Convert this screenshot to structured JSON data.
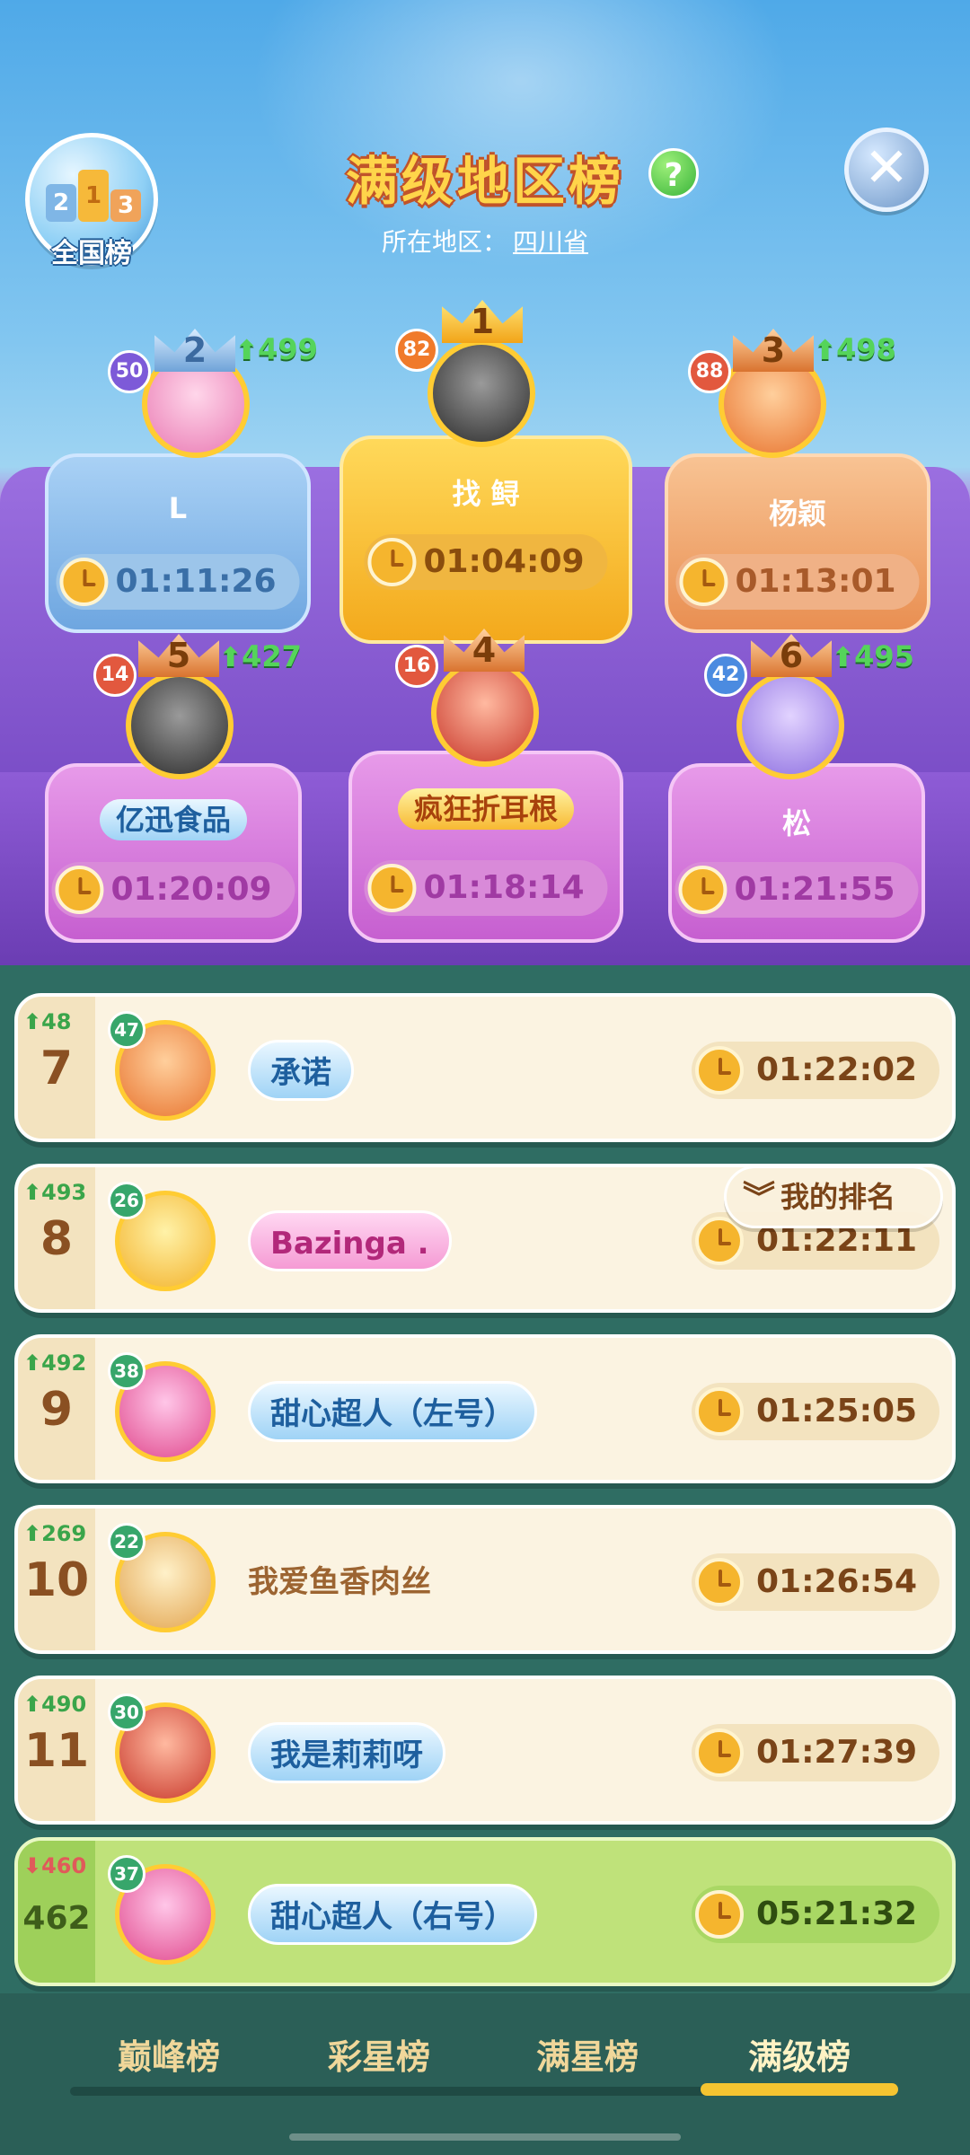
{
  "header": {
    "title": "满级地区榜",
    "region_label": "所在地区：",
    "region_value": "四川省",
    "national_button_label": "全国榜",
    "national_blocks": [
      "2",
      "1",
      "3"
    ]
  },
  "podium": [
    {
      "rank": "1",
      "name": "找 鲟",
      "time": "01:04:09",
      "level": "82",
      "change": ""
    },
    {
      "rank": "2",
      "name": "L",
      "time": "01:11:26",
      "level": "50",
      "change": "499"
    },
    {
      "rank": "3",
      "name": "杨颖",
      "time": "01:13:01",
      "level": "88",
      "change": "498"
    },
    {
      "rank": "4",
      "name": "疯狂折耳根",
      "time": "01:18:14",
      "level": "16",
      "change": ""
    },
    {
      "rank": "5",
      "name": "亿迅食品",
      "time": "01:20:09",
      "level": "14",
      "change": "427"
    },
    {
      "rank": "6",
      "name": "松",
      "time": "01:21:55",
      "level": "42",
      "change": "495"
    }
  ],
  "list": [
    {
      "rank": "7",
      "change": "48",
      "level": "47",
      "name": "承诺",
      "time": "01:22:02"
    },
    {
      "rank": "8",
      "change": "493",
      "level": "26",
      "name": "Bazinga .",
      "time": "01:22:11"
    },
    {
      "rank": "9",
      "change": "492",
      "level": "38",
      "name": "甜心超人（左号）",
      "time": "01:25:05"
    },
    {
      "rank": "10",
      "change": "269",
      "level": "22",
      "name": "我爱鱼香肉丝",
      "time": "01:26:54"
    },
    {
      "rank": "11",
      "change": "490",
      "level": "30",
      "name": "我是莉莉呀",
      "time": "01:27:39"
    },
    {
      "rank": "462",
      "change": "460",
      "level": "37",
      "name": "甜心超人（右号）",
      "time": "05:21:32"
    }
  ],
  "my_rank_button": "我的排名",
  "tabs": [
    "巅峰榜",
    "彩星榜",
    "满星榜",
    "满级榜"
  ],
  "active_tab": "满级榜",
  "icons": {
    "help": "?",
    "close": "✕",
    "chevron": "︾",
    "arrow_up": "⬆",
    "arrow_down": "⬇"
  },
  "colors": {
    "gold": "#ffd54a",
    "up": "#55d45a",
    "down": "#e05a5a",
    "active_tab_bar": "#f5c431"
  }
}
